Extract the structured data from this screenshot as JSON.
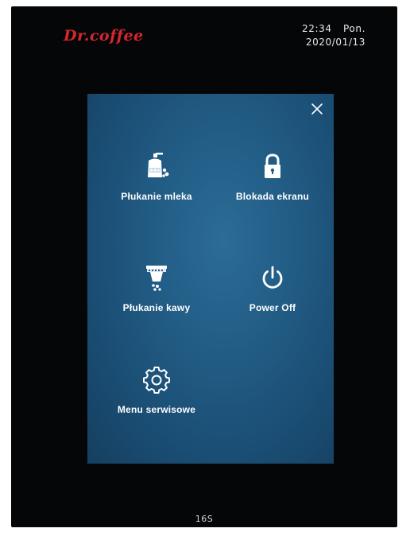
{
  "header": {
    "brand": "Dr.coffee",
    "time": "22:34",
    "weekday": "Pon.",
    "date": "2020/01/13"
  },
  "menu": {
    "close_icon": "close-icon",
    "items": [
      {
        "label": "Płukanie mleka",
        "icon": "milk-rinse-icon"
      },
      {
        "label": "Blokada ekranu",
        "icon": "lock-icon"
      },
      {
        "label": "Płukanie kawy",
        "icon": "coffee-rinse-icon"
      },
      {
        "label": "Power Off",
        "icon": "power-icon"
      },
      {
        "label": "Menu serwisowe",
        "icon": "gear-icon"
      }
    ]
  },
  "footer": {
    "code": "16S"
  },
  "colors": {
    "brand": "#d8262e",
    "panel": "#225d86",
    "text": "#ffffff",
    "background": "#050608"
  }
}
